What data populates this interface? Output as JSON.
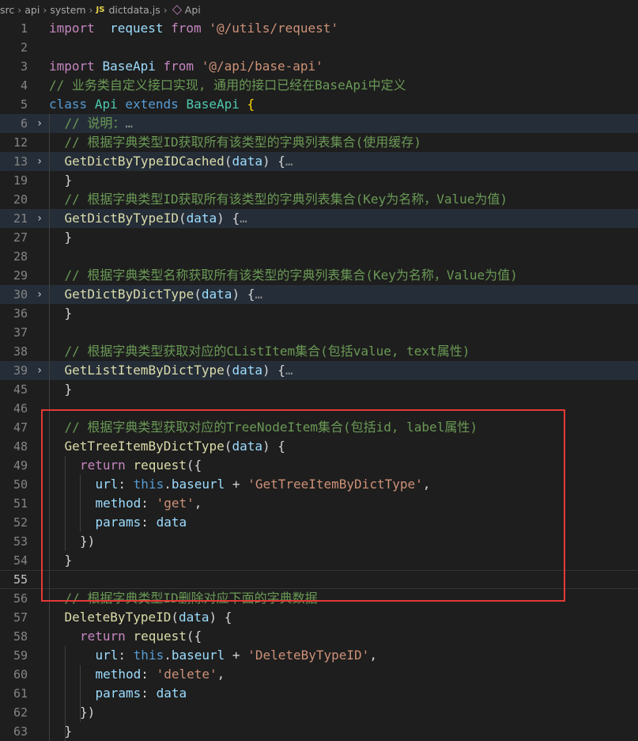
{
  "breadcrumb": {
    "items": [
      "src",
      "api",
      "system"
    ],
    "file": "dictdata.js",
    "symbol": "Api"
  },
  "lines": [
    {
      "n": "1",
      "code": [
        [
          "kw2",
          "import"
        ],
        [
          "",
          "  "
        ],
        [
          "var",
          "request"
        ],
        [
          "",
          " "
        ],
        [
          "kw2",
          "from"
        ],
        [
          "",
          " "
        ],
        [
          "str",
          "'@/utils/request'"
        ]
      ]
    },
    {
      "n": "2",
      "code": []
    },
    {
      "n": "3",
      "code": [
        [
          "kw2",
          "import"
        ],
        [
          "",
          " "
        ],
        [
          "var",
          "BaseApi"
        ],
        [
          "",
          " "
        ],
        [
          "kw2",
          "from"
        ],
        [
          "",
          " "
        ],
        [
          "str",
          "'@/api/base-api'"
        ]
      ]
    },
    {
      "n": "4",
      "code": [
        [
          "cm",
          "// 业务类自定义接口实现, 通用的接口已经在BaseApi中定义"
        ]
      ]
    },
    {
      "n": "5",
      "code": [
        [
          "kw",
          "class"
        ],
        [
          "",
          " "
        ],
        [
          "cls",
          "Api"
        ],
        [
          "",
          " "
        ],
        [
          "kw",
          "extends"
        ],
        [
          "",
          " "
        ],
        [
          "cls",
          "BaseApi"
        ],
        [
          "",
          " "
        ],
        [
          "brk",
          "{"
        ]
      ]
    },
    {
      "n": "6",
      "fold": true,
      "indent": 1,
      "code": [
        [
          "cm",
          "// 说明："
        ],
        [
          "ellipsis",
          "…"
        ]
      ]
    },
    {
      "n": "12",
      "indent": 1,
      "code": [
        [
          "cm",
          "// 根据字典类型ID获取所有该类型的字典列表集合(使用缓存)"
        ]
      ]
    },
    {
      "n": "13",
      "fold": true,
      "indent": 1,
      "code": [
        [
          "fn",
          "GetDictByTypeIDCached"
        ],
        [
          "",
          "("
        ],
        [
          "var",
          "data"
        ],
        [
          "",
          ") {"
        ],
        [
          "ellipsis",
          "…"
        ]
      ]
    },
    {
      "n": "19",
      "indent": 1,
      "code": [
        [
          "",
          "}"
        ]
      ]
    },
    {
      "n": "20",
      "indent": 1,
      "code": [
        [
          "cm",
          "// 根据字典类型ID获取所有该类型的字典列表集合(Key为名称，Value为值)"
        ]
      ]
    },
    {
      "n": "21",
      "fold": true,
      "indent": 1,
      "code": [
        [
          "fn",
          "GetDictByTypeID"
        ],
        [
          "",
          "("
        ],
        [
          "var",
          "data"
        ],
        [
          "",
          ") {"
        ],
        [
          "ellipsis",
          "…"
        ]
      ]
    },
    {
      "n": "27",
      "indent": 1,
      "code": [
        [
          "",
          "}"
        ]
      ]
    },
    {
      "n": "28",
      "code": []
    },
    {
      "n": "29",
      "indent": 1,
      "code": [
        [
          "cm",
          "// 根据字典类型名称获取所有该类型的字典列表集合(Key为名称，Value为值)"
        ]
      ]
    },
    {
      "n": "30",
      "fold": true,
      "indent": 1,
      "code": [
        [
          "fn",
          "GetDictByDictType"
        ],
        [
          "",
          "("
        ],
        [
          "var",
          "data"
        ],
        [
          "",
          ") {"
        ],
        [
          "ellipsis",
          "…"
        ]
      ]
    },
    {
      "n": "36",
      "indent": 1,
      "code": [
        [
          "",
          "}"
        ]
      ]
    },
    {
      "n": "37",
      "code": []
    },
    {
      "n": "38",
      "indent": 1,
      "code": [
        [
          "cm",
          "// 根据字典类型获取对应的CListItem集合(包括value, text属性)"
        ]
      ]
    },
    {
      "n": "39",
      "fold": true,
      "indent": 1,
      "code": [
        [
          "fn",
          "GetListItemByDictType"
        ],
        [
          "",
          "("
        ],
        [
          "var",
          "data"
        ],
        [
          "",
          ") {"
        ],
        [
          "ellipsis",
          "…"
        ]
      ]
    },
    {
      "n": "45",
      "indent": 1,
      "code": [
        [
          "",
          "}"
        ]
      ]
    },
    {
      "n": "46",
      "code": []
    },
    {
      "n": "47",
      "indent": 1,
      "code": [
        [
          "cm",
          "// 根据字典类型获取对应的TreeNodeItem集合(包括id, label属性)"
        ]
      ]
    },
    {
      "n": "48",
      "indent": 1,
      "code": [
        [
          "fn",
          "GetTreeItemByDictType"
        ],
        [
          "",
          "("
        ],
        [
          "var",
          "data"
        ],
        [
          "",
          ") {"
        ]
      ]
    },
    {
      "n": "49",
      "indent": 2,
      "code": [
        [
          "kw2",
          "return"
        ],
        [
          "",
          " "
        ],
        [
          "fn",
          "request"
        ],
        [
          "",
          "({"
        ]
      ]
    },
    {
      "n": "50",
      "indent": 3,
      "code": [
        [
          "var",
          "url"
        ],
        [
          "",
          ": "
        ],
        [
          "kw",
          "this"
        ],
        [
          "",
          "."
        ],
        [
          "var",
          "baseurl"
        ],
        [
          "",
          " + "
        ],
        [
          "str",
          "'GetTreeItemByDictType'"
        ],
        [
          "",
          ","
        ]
      ]
    },
    {
      "n": "51",
      "indent": 3,
      "code": [
        [
          "var",
          "method"
        ],
        [
          "",
          ": "
        ],
        [
          "str",
          "'get'"
        ],
        [
          "",
          ","
        ]
      ]
    },
    {
      "n": "52",
      "indent": 3,
      "code": [
        [
          "var",
          "params"
        ],
        [
          "",
          ": "
        ],
        [
          "var",
          "data"
        ]
      ]
    },
    {
      "n": "53",
      "indent": 2,
      "code": [
        [
          "",
          "})"
        ]
      ]
    },
    {
      "n": "54",
      "indent": 1,
      "code": [
        [
          "",
          "}"
        ]
      ]
    },
    {
      "n": "55",
      "active": true,
      "code": []
    },
    {
      "n": "56",
      "indent": 1,
      "code": [
        [
          "cm",
          "// 根据字典类型ID删除对应下面的字典数据"
        ]
      ]
    },
    {
      "n": "57",
      "indent": 1,
      "code": [
        [
          "fn",
          "DeleteByTypeID"
        ],
        [
          "",
          "("
        ],
        [
          "var",
          "data"
        ],
        [
          "",
          ") {"
        ]
      ]
    },
    {
      "n": "58",
      "indent": 2,
      "code": [
        [
          "kw2",
          "return"
        ],
        [
          "",
          " "
        ],
        [
          "fn",
          "request"
        ],
        [
          "",
          "({"
        ]
      ]
    },
    {
      "n": "59",
      "indent": 3,
      "code": [
        [
          "var",
          "url"
        ],
        [
          "",
          ": "
        ],
        [
          "kw",
          "this"
        ],
        [
          "",
          "."
        ],
        [
          "var",
          "baseurl"
        ],
        [
          "",
          " + "
        ],
        [
          "str",
          "'DeleteByTypeID'"
        ],
        [
          "",
          ","
        ]
      ]
    },
    {
      "n": "60",
      "indent": 3,
      "code": [
        [
          "var",
          "method"
        ],
        [
          "",
          ": "
        ],
        [
          "str",
          "'delete'"
        ],
        [
          "",
          ","
        ]
      ]
    },
    {
      "n": "61",
      "indent": 3,
      "code": [
        [
          "var",
          "params"
        ],
        [
          "",
          ": "
        ],
        [
          "var",
          "data"
        ]
      ]
    },
    {
      "n": "62",
      "indent": 2,
      "code": [
        [
          "",
          "})"
        ]
      ]
    },
    {
      "n": "63",
      "indent": 1,
      "code": [
        [
          "",
          "}"
        ]
      ]
    }
  ]
}
